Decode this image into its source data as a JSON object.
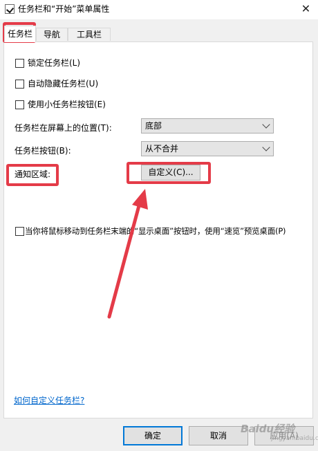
{
  "window": {
    "title": "任务栏和“开始”菜单属性",
    "close_glyph": "✕"
  },
  "tabs": [
    {
      "label": "任务栏",
      "active": true
    },
    {
      "label": "导航",
      "active": false
    },
    {
      "label": "工具栏",
      "active": false
    }
  ],
  "options": {
    "lock_taskbar": {
      "label": "锁定任务栏(L)",
      "checked": false
    },
    "auto_hide": {
      "label": "自动隐藏任务栏(U)",
      "checked": false
    },
    "small_buttons": {
      "label": "使用小任务栏按钮(E)",
      "checked": false
    }
  },
  "location": {
    "label": "任务栏在屏幕上的位置(T):",
    "value": "底部"
  },
  "buttons_combine": {
    "label": "任务栏按钮(B):",
    "value": "从不合并"
  },
  "notification": {
    "label": "通知区域:",
    "customize_label": "自定义(C)..."
  },
  "peek": {
    "label": "当你将鼠标移动到任务栏末端的“显示桌面”按钮时，使用“速览”预览桌面(P)",
    "checked": false
  },
  "help_link": "如何自定义任务栏?",
  "footer": {
    "ok_label": "确定",
    "cancel_label": "取消",
    "apply_label": "应用(A)"
  },
  "annotations": {
    "color": "#e43b48"
  },
  "watermark": {
    "text": "Baidu经验",
    "subtext": "jingyan.baidu.com"
  }
}
